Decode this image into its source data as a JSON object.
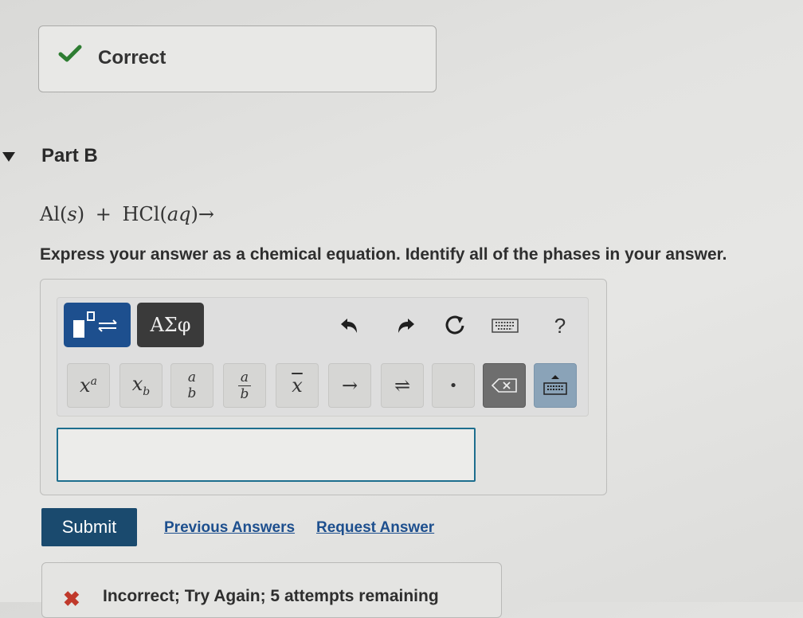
{
  "feedback_top": {
    "text": "Correct",
    "icon": "checkmark-icon",
    "color": "#2e7d32"
  },
  "part": {
    "title": "Part B",
    "toggle_icon": "triangle-down-icon"
  },
  "question": {
    "equation": {
      "al": "Al",
      "s": "s",
      "plus": "+",
      "hcl": "HCl",
      "aq": "aq",
      "arrow": "→"
    },
    "instruction": "Express your answer as a chemical equation. Identify all of the phases in your answer."
  },
  "toolbar": {
    "templates_icon": "templates-icon",
    "greek_label": "ΑΣφ",
    "undo_icon": "undo-icon",
    "redo_icon": "redo-icon",
    "reset_icon": "reset-icon",
    "keyboard_icon": "keyboard-icon",
    "help_label": "?"
  },
  "keys": {
    "superscript": {
      "base": "x",
      "sup": "a"
    },
    "subscript": {
      "base": "x",
      "sub": "b"
    },
    "fraction": {
      "num": "a",
      "den": "b"
    },
    "fraction_bar": {
      "num": "a",
      "den": "b"
    },
    "overline": "x",
    "arrow": "→",
    "equilibrium": "⇌",
    "dot": "•",
    "delete_icon": "backspace-icon",
    "keyboard_icon": "keyboard-up-icon"
  },
  "answer_input": {
    "value": ""
  },
  "actions": {
    "submit": "Submit",
    "previous_answers": "Previous Answers",
    "request_answer": "Request Answer"
  },
  "feedback_bottom": {
    "text": "Incorrect; Try Again; 5 attempts remaining",
    "icon": "x-icon",
    "color": "#c0392b"
  }
}
